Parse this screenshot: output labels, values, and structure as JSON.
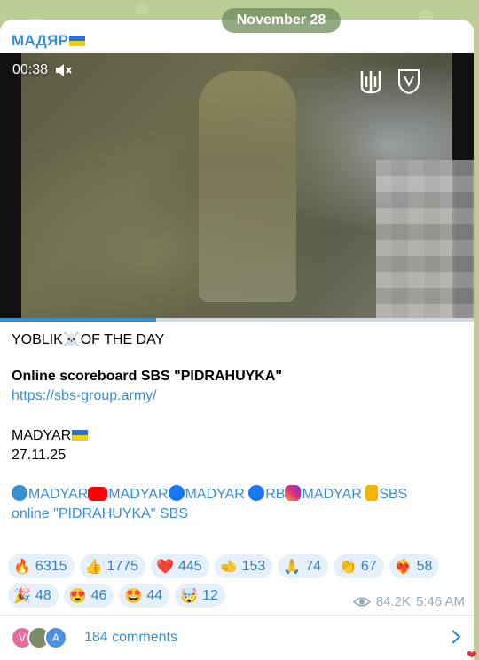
{
  "date_pill": "November 28",
  "channel": {
    "name": "МАДЯР"
  },
  "video": {
    "duration": "00:38",
    "progress": 0.33
  },
  "post": {
    "line1_text": "YOBLIK",
    "line1_suffix": "OF THE DAY",
    "scoreboard": "Online scoreboard SBS \"PIDRAHUYKA\"",
    "url": "https://sbs-group.army/",
    "signature": "MADYAR",
    "date": "27.11.25",
    "social": {
      "telegram": "MADYAR",
      "youtube": "MADYAR",
      "facebook": "MADYAR",
      "facebook_rb": "RB",
      "instagram": "MADYAR",
      "sbs": "SBS",
      "online": "online \"PIDRAHUYKA\" SBS"
    }
  },
  "reactions": [
    {
      "emoji": "🔥",
      "count": "6315"
    },
    {
      "emoji": "👍",
      "count": "1775"
    },
    {
      "emoji": "❤️",
      "count": "445"
    },
    {
      "emoji": "🫲",
      "count": "153"
    },
    {
      "emoji": "🙏",
      "count": "74"
    },
    {
      "emoji": "👏",
      "count": "67"
    },
    {
      "emoji": "❤️‍🔥",
      "count": "58"
    },
    {
      "emoji": "🎉",
      "count": "48"
    },
    {
      "emoji": "😍",
      "count": "46"
    },
    {
      "emoji": "🤩",
      "count": "44"
    },
    {
      "emoji": "🤯",
      "count": "12"
    }
  ],
  "meta": {
    "views": "84.2K",
    "time": "5:46 AM"
  },
  "comments": {
    "avatars": [
      "V",
      "",
      "A"
    ],
    "label": "184 comments"
  },
  "colors": {
    "accent": "#3a8fd0",
    "background": "#b9cf97"
  }
}
